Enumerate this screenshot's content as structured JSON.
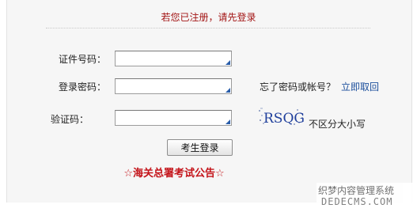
{
  "header": {
    "note": "若您已注册，请先登录"
  },
  "form": {
    "id_label": "证件号码：",
    "id_value": "",
    "password_label": "登录密码：",
    "password_value": "",
    "captcha_label": "验证码：",
    "captcha_value": "",
    "captcha_image_text": "RSQG",
    "captcha_note": "不区分大小写",
    "forgot_text": "忘了密码或帐号？",
    "forgot_link": "立即取回",
    "submit_label": "考生登录"
  },
  "notice": {
    "text": "☆海关总署考试公告☆"
  },
  "watermark": {
    "line1": "织梦内容管理系统",
    "line2": "DEDECMS.COM"
  },
  "colors": {
    "header_note": "#a31515",
    "notice": "#c4141a",
    "link": "#1c4f9c",
    "panel_bg": "#f6f6f6",
    "input_corner": "#2a5da9"
  }
}
